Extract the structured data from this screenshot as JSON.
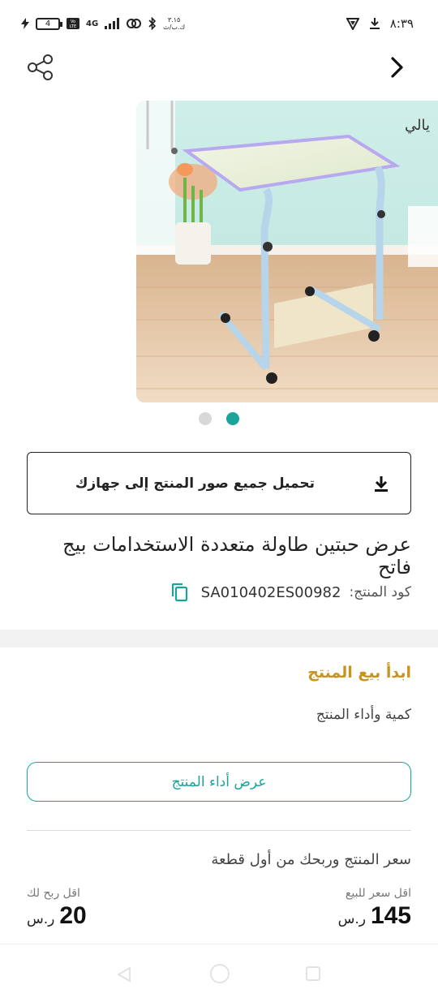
{
  "status_bar": {
    "time": "٨:٣٩",
    "battery": "4",
    "network": "4G",
    "data_speed": "٣.١٥\nك.ب/ث",
    "icons": [
      "charging-icon",
      "battery-icon",
      "volte-icon",
      "signal-icon",
      "link-icon",
      "bluetooth-icon",
      "vpn-icon",
      "download-icon"
    ]
  },
  "topbar": {
    "icons": [
      "share-icon",
      "chevron-right-icon"
    ]
  },
  "carousel": {
    "image_alt": "product-photo-table",
    "dot_count": 2,
    "active_index": 1
  },
  "download_button": {
    "label": "تحميل جميع صور المنتج إلى جهازك"
  },
  "product": {
    "title": "عرض حبتين  طاولة متعددة الاستخدامات بيج فاتح",
    "code_label": "كود المنتج:",
    "code_value": "SA010402ES00982"
  },
  "selling": {
    "heading": "ابدأ بيع المنتج",
    "qty_perf": "كمية وأداء المنتج",
    "view_perf_button": "عرض أداء المنتج"
  },
  "pricing": {
    "heading": "سعر المنتج وربحك من أول قطعة",
    "min_sell_label": "اقل سعر للبيع",
    "min_sell_value": "145",
    "min_profit_label": "اقل ربح لك",
    "min_profit_value": "20",
    "currency": "ر.س"
  },
  "colors": {
    "accent": "#1aa59a",
    "gold": "#c8941e",
    "text": "#222222"
  }
}
